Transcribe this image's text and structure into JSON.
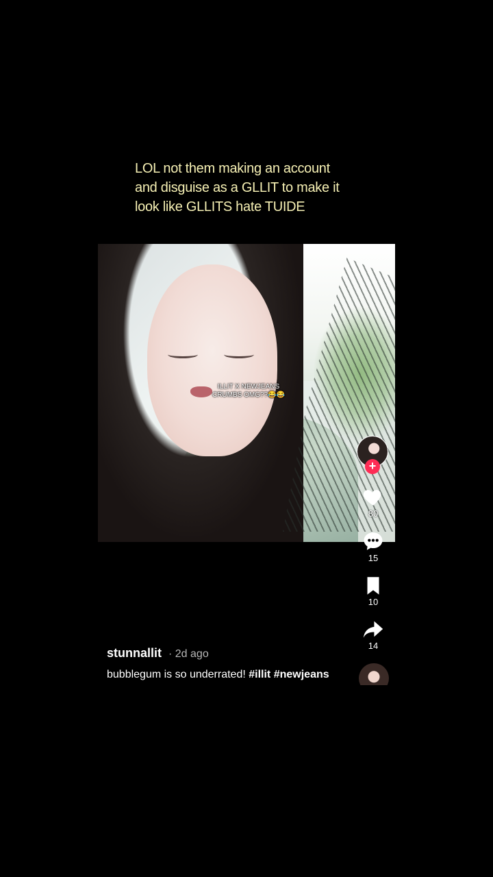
{
  "caption": {
    "line1": "LOL not them making an account",
    "line2": "and disguise as a GLLIT to make it",
    "line3": "look like GLLITS hate TUIDE"
  },
  "video": {
    "overlay_line1": "ILLIT X NEWJEANS",
    "overlay_line2": "CRUMBS OMG??😂😂"
  },
  "actions": {
    "follow_symbol": "+",
    "likes": "80",
    "comments": "15",
    "saves": "10",
    "shares": "14"
  },
  "post": {
    "username": "stunnallit",
    "time": "· 2d ago",
    "description_text": "bubblegum is so underrated! ",
    "tags": [
      "#illit",
      "#newjeans"
    ]
  },
  "colors": {
    "caption": "#f6f0b4",
    "follow": "#fe2c55"
  },
  "icons": [
    "heart-icon",
    "comment-icon",
    "bookmark-icon",
    "share-icon"
  ]
}
